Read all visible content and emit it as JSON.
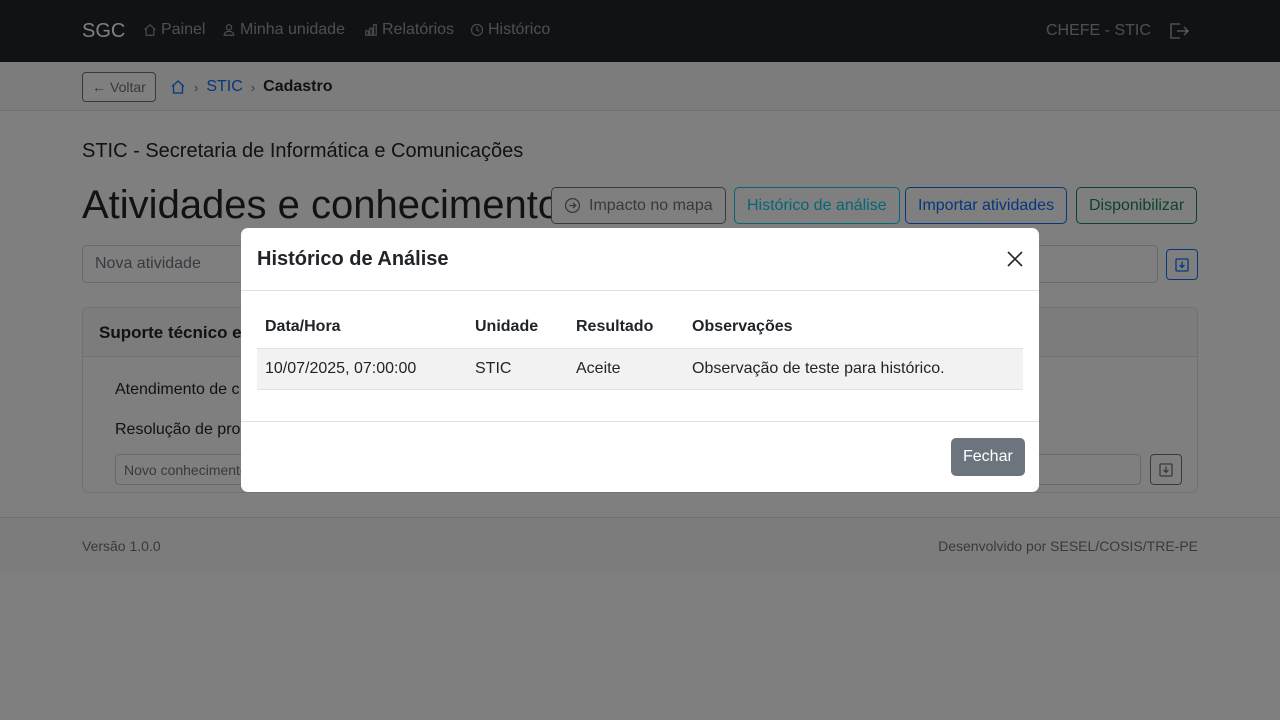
{
  "navbar": {
    "brand": "SGC",
    "items": [
      {
        "label": "Painel",
        "icon": "house-icon"
      },
      {
        "label": "Minha unidade",
        "icon": "person-icon"
      },
      {
        "label": "Relatórios",
        "icon": "bar-chart-icon"
      },
      {
        "label": "Histórico",
        "icon": "clock-icon"
      }
    ],
    "user": "CHEFE - STIC",
    "logout_icon": "logout-icon"
  },
  "breadcrumb": {
    "back_label": "Voltar",
    "items": [
      "STIC",
      "Cadastro"
    ],
    "separator": "›"
  },
  "page": {
    "unit_title": "STIC - Secretaria de Informática e Comunicações",
    "title": "Atividades e conhecimentos",
    "buttons": {
      "impact": "Impacto no mapa",
      "history": "Histórico de análise",
      "import": "Importar atividades",
      "publish": "Disponibilizar"
    },
    "new_activity_placeholder": "Nova atividade"
  },
  "activity_card": {
    "title": "Suporte técnico e",
    "knowledge": [
      "Atendimento de c",
      "Resolução de prob"
    ],
    "new_knowledge_placeholder": "Novo conhecimento"
  },
  "footer": {
    "version": "Versão 1.0.0",
    "credits": "Desenvolvido por SESEL/COSIS/TRE-PE"
  },
  "modal": {
    "title": "Histórico de Análise",
    "columns": [
      "Data/Hora",
      "Unidade",
      "Resultado",
      "Observações"
    ],
    "rows": [
      [
        "10/07/2025, 07:00:00",
        "STIC",
        "Aceite",
        "Observação de teste para histórico."
      ]
    ],
    "close_label": "Fechar"
  },
  "colors": {
    "navbar_bg": "#212529",
    "primary": "#0d6efd",
    "info": "#0dcaf0",
    "success": "#198754",
    "secondary": "#6c757d"
  }
}
